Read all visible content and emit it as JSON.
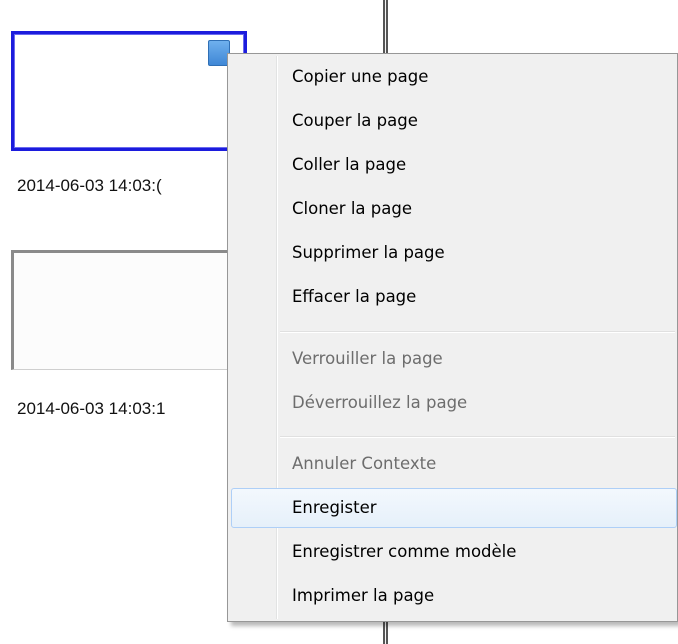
{
  "thumbnails": [
    {
      "number_fragment": ":",
      "timestamp": "2014-06-03 14:03:("
    },
    {
      "number_fragment": ":",
      "timestamp": "2014-06-03 14:03:1"
    }
  ],
  "colors": {
    "selected_border": "#1c1cdd",
    "menu_background": "#f0f0f0",
    "hover_border": "#aecff7",
    "disabled_text": "#6d6d6d"
  },
  "context_menu": {
    "items": [
      {
        "label": "Copier une page",
        "enabled": true
      },
      {
        "label": "Couper la page",
        "enabled": true
      },
      {
        "label": "Coller la page",
        "enabled": true
      },
      {
        "label": "Cloner la page",
        "enabled": true
      },
      {
        "label": "Supprimer la page",
        "enabled": true
      },
      {
        "label": "Effacer la page",
        "enabled": true
      },
      {
        "label": "Verrouiller la page",
        "enabled": false
      },
      {
        "label": "Déverrouillez la page",
        "enabled": false
      },
      {
        "label": "Annuler Contexte",
        "enabled": false
      },
      {
        "label": "Enregister",
        "enabled": true,
        "hovered": true
      },
      {
        "label": "Enregistrer comme modèle",
        "enabled": true
      },
      {
        "label": "Imprimer la page",
        "enabled": true
      }
    ]
  }
}
